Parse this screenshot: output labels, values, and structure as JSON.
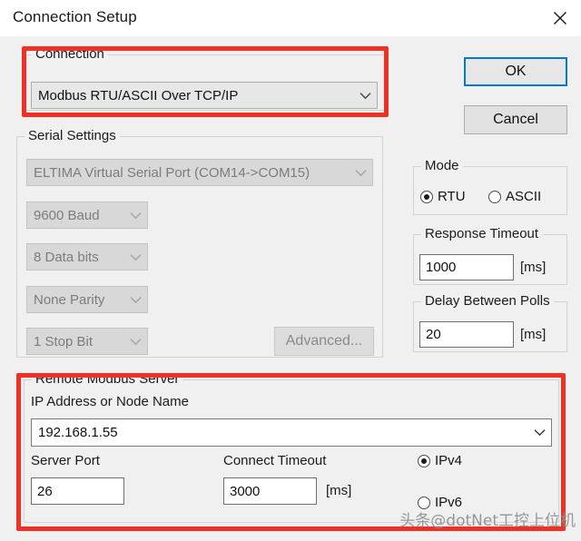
{
  "window": {
    "title": "Connection Setup",
    "close_icon": "close-icon"
  },
  "connection_group": {
    "legend": "Connection",
    "combo_value": "Modbus RTU/ASCII Over TCP/IP",
    "chevron_icon": "chevron-down-icon"
  },
  "serial_settings": {
    "legend": "Serial Settings",
    "port_value": "ELTIMA Virtual Serial Port (COM14->COM15)",
    "baud_value": "9600 Baud",
    "databits_value": "8 Data bits",
    "parity_value": "None Parity",
    "stopbits_value": "1 Stop Bit",
    "advanced_label": "Advanced..."
  },
  "buttons": {
    "ok_label": "OK",
    "cancel_label": "Cancel"
  },
  "mode_group": {
    "legend": "Mode",
    "options": [
      {
        "label": "RTU",
        "selected": true
      },
      {
        "label": "ASCII",
        "selected": false
      }
    ]
  },
  "response_timeout": {
    "legend": "Response Timeout",
    "value": "1000",
    "unit": "[ms]"
  },
  "delay_between_polls": {
    "legend": "Delay Between Polls",
    "value": "20",
    "unit": "[ms]"
  },
  "remote_server": {
    "legend": "Remote Modbus Server",
    "ip_label": "IP Address or Node Name",
    "ip_value": "192.168.1.55",
    "server_port_label": "Server Port",
    "server_port_value": "26",
    "connect_timeout_label": "Connect Timeout",
    "connect_timeout_value": "3000",
    "connect_timeout_unit": "[ms]",
    "ip_versions": [
      {
        "label": "IPv4",
        "selected": true
      },
      {
        "label": "IPv6",
        "selected": false
      }
    ]
  },
  "watermark": {
    "text": "头条@dotNet工控上位机"
  },
  "colors": {
    "annotation_red": "#ee3124",
    "default_button_focus": "#0078d7",
    "window_background": "#f0f0f0"
  }
}
